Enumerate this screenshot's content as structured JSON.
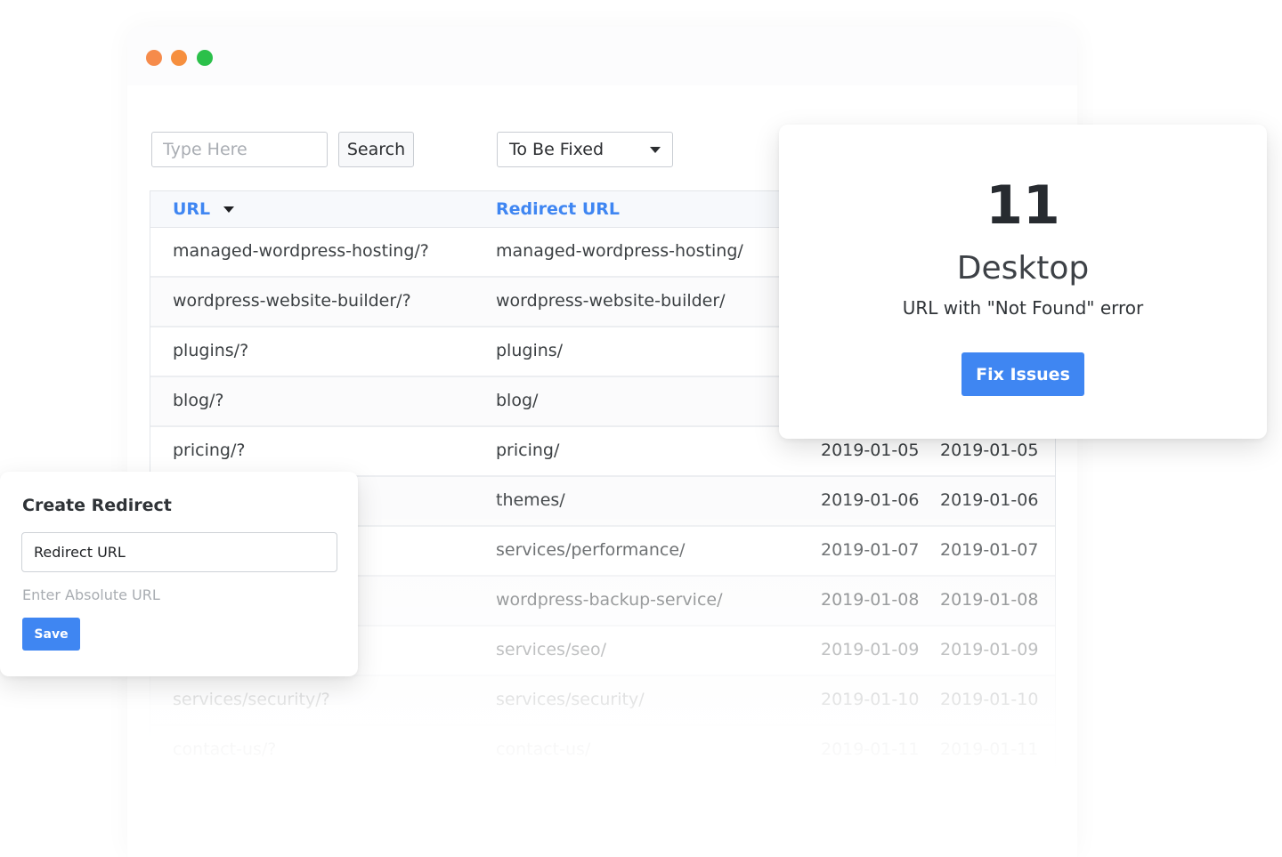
{
  "window": {
    "controls": [
      {
        "name": "close",
        "color": "#f68b4b"
      },
      {
        "name": "minimize",
        "color": "#f68f3e"
      },
      {
        "name": "maximize",
        "color": "#2bc04a"
      }
    ]
  },
  "toolbar": {
    "search_placeholder": "Type Here",
    "search_label": "Search",
    "filter_selected": "To Be Fixed"
  },
  "table": {
    "columns": [
      "URL",
      "Redirect URL"
    ],
    "rows": [
      {
        "url": "managed-wordpress-hosting/?",
        "redirect": "managed-wordpress-hosting/",
        "d1": "",
        "d2": ""
      },
      {
        "url": "wordpress-website-builder/?",
        "redirect": "wordpress-website-builder/",
        "d1": "",
        "d2": ""
      },
      {
        "url": "plugins/?",
        "redirect": "plugins/",
        "d1": "",
        "d2": ""
      },
      {
        "url": "blog/?",
        "redirect": "blog/",
        "d1": "",
        "d2": ""
      },
      {
        "url": "pricing/?",
        "redirect": "pricing/",
        "d1": "2019-01-05",
        "d2": "2019-01-05"
      },
      {
        "url": "",
        "redirect": "themes/",
        "d1": "2019-01-06",
        "d2": "2019-01-06"
      },
      {
        "url": "",
        "redirect": "services/performance/",
        "d1": "2019-01-07",
        "d2": "2019-01-07"
      },
      {
        "url": "",
        "redirect": "wordpress-backup-service/",
        "d1": "2019-01-08",
        "d2": "2019-01-08"
      },
      {
        "url": "",
        "redirect": "services/seo/",
        "d1": "2019-01-09",
        "d2": "2019-01-09"
      },
      {
        "url": "services/security/?",
        "redirect": "services/security/",
        "d1": "2019-01-10",
        "d2": "2019-01-10"
      },
      {
        "url": "contact-us/?",
        "redirect": "contact-us/",
        "d1": "2019-01-11",
        "d2": "2019-01-11"
      }
    ]
  },
  "summary": {
    "count": "11",
    "title": "Desktop",
    "subtitle": "URL with \"Not Found\" error",
    "action_label": "Fix Issues"
  },
  "redirect_panel": {
    "title": "Create Redirect",
    "input_value": "Redirect URL",
    "hint": "Enter Absolute URL",
    "save_label": "Save"
  },
  "colors": {
    "accent": "#3f86f2",
    "text": "#3c4043"
  }
}
